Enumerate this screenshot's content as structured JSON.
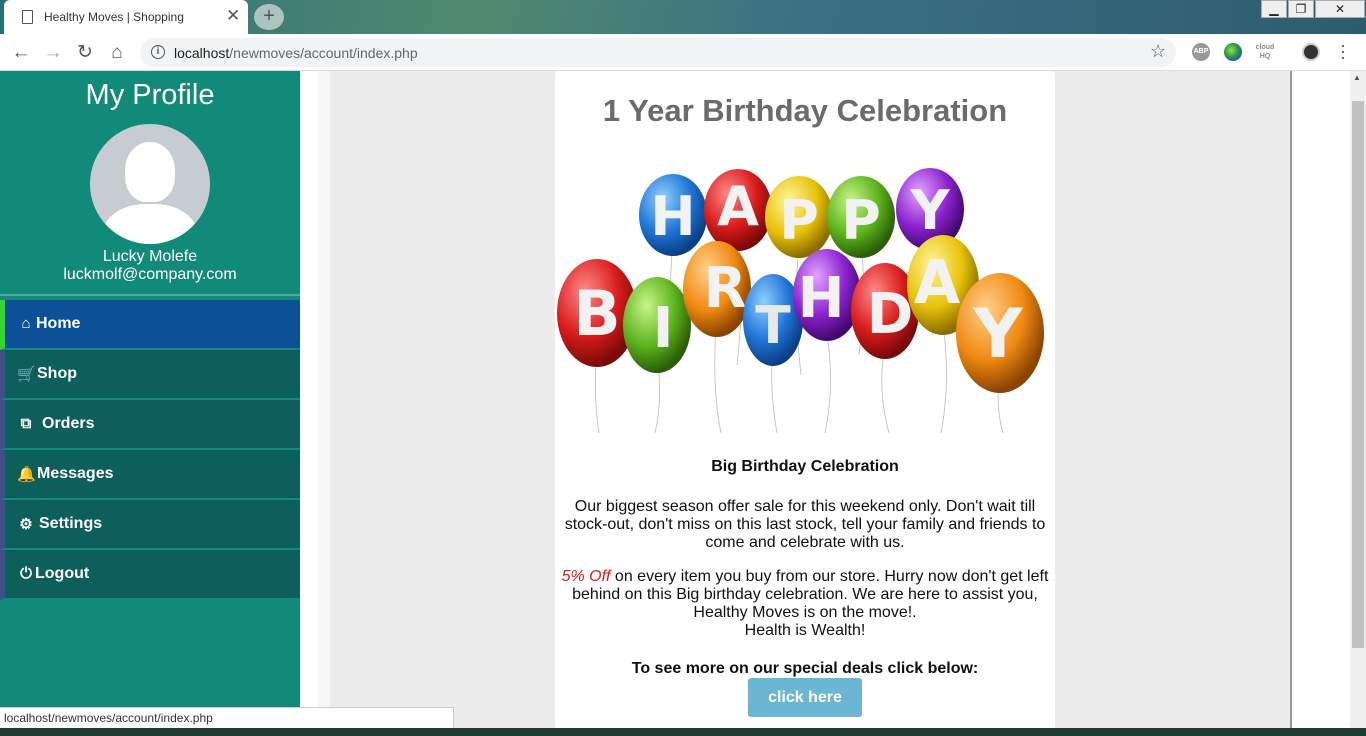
{
  "browser": {
    "tab_title": "Healthy Moves | Shopping",
    "close_glyph": "✕",
    "newtab_glyph": "+",
    "url_host": "localhost",
    "url_path": "/newmoves/account/index.php",
    "ext_abp": "ABP",
    "ext_cloud": "cloud HQ",
    "status_url": "localhost/newmoves/account/index.php"
  },
  "sidebar": {
    "title": "My Profile",
    "user_name": "Lucky Molefe",
    "user_email": "luckmolf@company.com",
    "items": [
      {
        "label": "Home",
        "icon": "home-icon",
        "glyph": "⌂"
      },
      {
        "label": "Shop",
        "icon": "cart-icon",
        "glyph": "🛒"
      },
      {
        "label": "Orders",
        "icon": "cubes-icon",
        "glyph": "⧉"
      },
      {
        "label": "Messages",
        "icon": "bell-icon",
        "glyph": "🔔"
      },
      {
        "label": "Settings",
        "icon": "gears-icon",
        "glyph": "⚙"
      },
      {
        "label": "Logout",
        "icon": "power-icon",
        "glyph": "⏻"
      }
    ]
  },
  "card": {
    "title": "1 Year Birthday Celebration",
    "banner_text": "HAPPY BIRTHDAY",
    "heading": "Big Birthday Celebration",
    "paragraph1": "Our biggest season offer sale for this weekend only. Don't wait till stock-out, don't miss on this last stock, tell your family and friends to come and celebrate with us.",
    "offer": "5% Off",
    "paragraph2_rest": " on every item you buy from our store. Hurry now don't get left behind on this Big birthday celebration. We are here to assist you,",
    "paragraph2_line3": "Healthy Moves is on the move!.",
    "paragraph2_line4": "Health is Wealth!",
    "cta_text": "To see more on our special deals click below:",
    "cta_button": "click here"
  },
  "colors": {
    "sidebar_bg": "#128a7a",
    "nav_bg": "#0d5f5c",
    "nav_active_bg": "#0c5097",
    "nav_active_accent": "#34d72a",
    "cta_button_bg": "#6ab6d3",
    "offer_red": "#e01818"
  }
}
